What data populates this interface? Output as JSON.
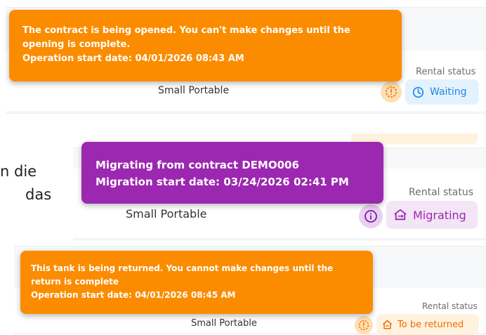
{
  "notices": [
    {
      "line1": "The contract is being opened. You can't make changes until the",
      "line2": "opening is complete.",
      "line3": "Operation start date: 04/01/2026 08:43 AM",
      "color": "#fb8c00"
    },
    {
      "line1": "Migrating from contract DEMO006",
      "line2": "Migration start date: 03/24/2026 02:41 PM",
      "color": "#9c27b0"
    },
    {
      "line1": "This tank is being returned. You cannot make changes until the",
      "line2": "return is complete",
      "line3": "Operation start date: 04/01/2026 08:45 AM",
      "color": "#fb8c00"
    }
  ],
  "rows": [
    {
      "product": "Small Portable",
      "rental_status_label": "Rental status",
      "status": "Waiting",
      "status_icon": "clock-icon",
      "status_color": "#1e88e5",
      "status_bg": "#e3f2fd"
    },
    {
      "product": "Small Portable",
      "rental_status_label": "Rental status",
      "status": "Migrating",
      "status_icon": "migrating-icon",
      "status_color": "#9c27b0",
      "status_bg": "#f3e5f5"
    },
    {
      "product": "Small Portable",
      "rental_status_label": "Rental status",
      "status": "To be returned",
      "status_icon": "home-return-icon",
      "status_color": "#ef6c00",
      "status_bg": "#fff3e0"
    }
  ],
  "background_text": {
    "line1": "n die",
    "line2": "das"
  }
}
